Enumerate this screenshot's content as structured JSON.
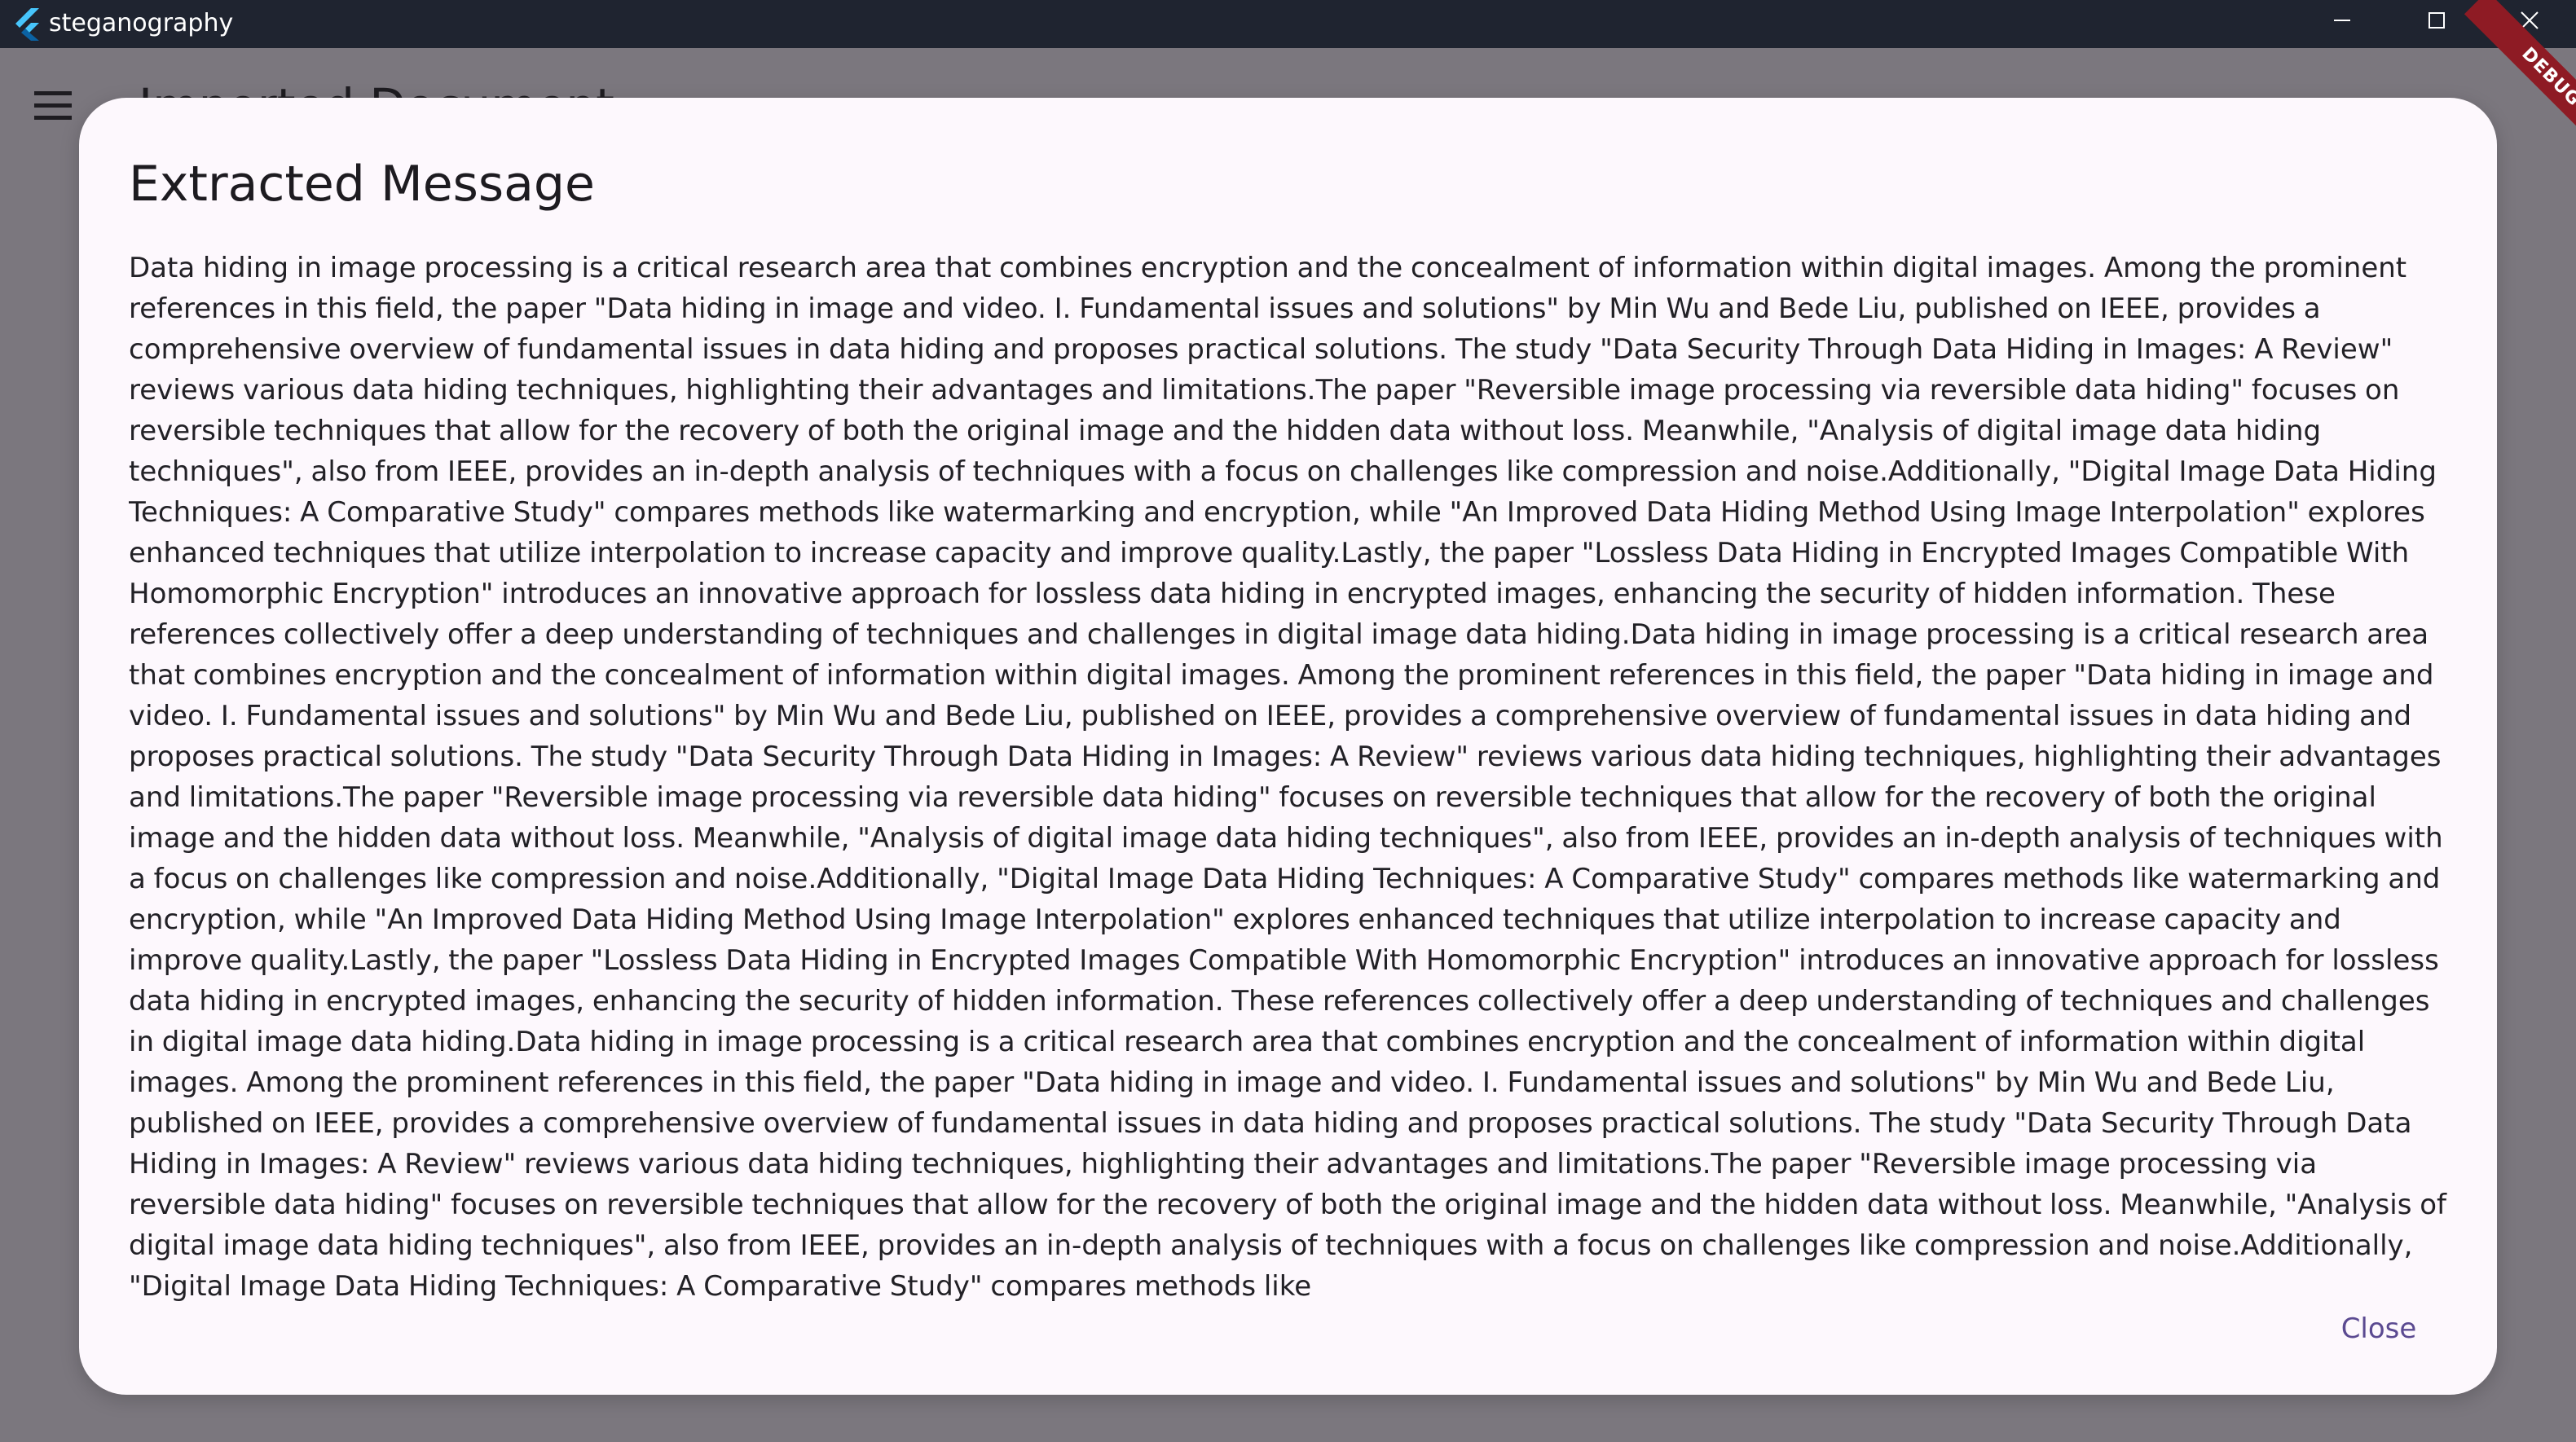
{
  "window": {
    "title": "steganography"
  },
  "background": {
    "page_heading": "Imported Document"
  },
  "debug_banner": "DEBUG",
  "dialog": {
    "title": "Extracted Message",
    "message": "Data hiding in image processing is a critical research area that combines encryption and the concealment of information within digital images. Among the prominent references in this field, the paper \"Data hiding in image and video. I. Fundamental issues and solutions\" by Min Wu and Bede Liu, published on IEEE, provides a comprehensive overview of fundamental issues in data hiding and proposes practical solutions. The study \"Data Security Through Data Hiding in Images: A Review\" reviews various data hiding techniques, highlighting their advantages and limitations.The paper \"Reversible image processing via reversible data hiding\" focuses on reversible techniques that allow for the recovery of both the original image and the hidden data without loss. Meanwhile, \"Analysis of digital image data hiding techniques\", also from IEEE, provides an in-depth analysis of techniques with a focus on challenges like compression and noise.Additionally, \"Digital Image Data Hiding Techniques: A Comparative Study\" compares methods like watermarking and encryption, while \"An Improved Data Hiding Method Using Image Interpolation\" explores enhanced techniques that utilize interpolation to increase capacity and improve quality.Lastly, the paper \"Lossless Data Hiding in Encrypted Images Compatible With Homomorphic Encryption\" introduces an innovative approach for lossless data hiding in encrypted images, enhancing the security of hidden information. These references collectively offer a deep understanding of techniques and challenges in digital image data hiding.Data hiding in image processing is a critical research area that combines encryption and the concealment of information within digital images. Among the prominent references in this field, the paper \"Data hiding in image and video. I. Fundamental issues and solutions\" by Min Wu and Bede Liu, published on IEEE, provides a comprehensive overview of fundamental issues in data hiding and proposes practical solutions. The study \"Data Security Through Data Hiding in Images: A Review\" reviews various data hiding techniques, highlighting their advantages and limitations.The paper \"Reversible image processing via reversible data hiding\" focuses on reversible techniques that allow for the recovery of both the original image and the hidden data without loss. Meanwhile, \"Analysis of digital image data hiding techniques\", also from IEEE, provides an in-depth analysis of techniques with a focus on challenges like compression and noise.Additionally, \"Digital Image Data Hiding Techniques: A Comparative Study\" compares methods like watermarking and encryption, while \"An Improved Data Hiding Method Using Image Interpolation\" explores enhanced techniques that utilize interpolation to increase capacity and improve quality.Lastly, the paper \"Lossless Data Hiding in Encrypted Images Compatible With Homomorphic Encryption\" introduces an innovative approach for lossless data hiding in encrypted images, enhancing the security of hidden information. These references collectively offer a deep understanding of techniques and challenges in digital image data hiding.Data hiding in image processing is a critical research area that combines encryption and the concealment of information within digital images. Among the prominent references in this field, the paper \"Data hiding in image and video. I. Fundamental issues and solutions\" by Min Wu and Bede Liu, published on IEEE, provides a comprehensive overview of fundamental issues in data hiding and proposes practical solutions. The study \"Data Security Through Data Hiding in Images: A Review\" reviews various data hiding techniques, highlighting their advantages and limitations.The paper \"Reversible image processing via reversible data hiding\" focuses on reversible techniques that allow for the recovery of both the original image and the hidden data without loss. Meanwhile, \"Analysis of digital image data hiding techniques\", also from IEEE, provides an in-depth analysis of techniques with a focus on challenges like compression and noise.Additionally, \"Digital Image Data Hiding Techniques: A Comparative Study\" compares methods like",
    "close_label": "Close"
  },
  "icons": {
    "app_logo": "flutter-logo-icon",
    "minimize": "minimize-icon",
    "maximize": "maximize-icon",
    "close": "close-icon",
    "menu": "hamburger-menu-icon"
  },
  "colors": {
    "titlebar": "#1f2430",
    "scrim": "#7b777e",
    "dialog_surface": "#fdf8fd",
    "accent": "#5b4a91",
    "debug_banner": "#8e1b24"
  }
}
